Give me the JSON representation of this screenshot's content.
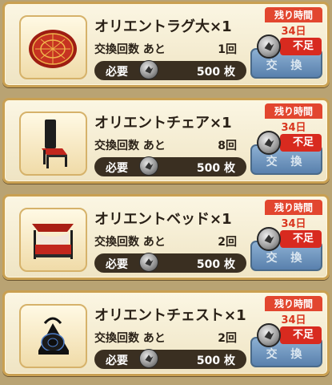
{
  "items": [
    {
      "name": "オリエントラグ大×1",
      "count_label": "交換回数 あと",
      "count_value": "1回",
      "need_label": "必要",
      "need_value": "500 枚",
      "timer_label": "残り時間",
      "timer_value": "34日",
      "shortage": "不足",
      "exchange_label": "交 換",
      "icon": "rug-icon"
    },
    {
      "name": "オリエントチェア×1",
      "count_label": "交換回数 あと",
      "count_value": "8回",
      "need_label": "必要",
      "need_value": "500 枚",
      "timer_label": "残り時間",
      "timer_value": "34日",
      "shortage": "不足",
      "exchange_label": "交 換",
      "icon": "chair-icon"
    },
    {
      "name": "オリエントベッド×1",
      "count_label": "交換回数 あと",
      "count_value": "2回",
      "need_label": "必要",
      "need_value": "500 枚",
      "timer_label": "残り時間",
      "timer_value": "34日",
      "shortage": "不足",
      "exchange_label": "交 換",
      "icon": "bed-icon"
    },
    {
      "name": "オリエントチェスト×1",
      "count_label": "交換回数 あと",
      "count_value": "2回",
      "need_label": "必要",
      "need_value": "500 枚",
      "timer_label": "残り時間",
      "timer_value": "34日",
      "shortage": "不足",
      "exchange_label": "交 換",
      "icon": "chest-icon"
    }
  ],
  "colors": {
    "accent_red": "#e2462f",
    "button_blue": "#3f6fa9",
    "frame_gold": "#c9a052",
    "bar_dark": "#3a2f21"
  }
}
